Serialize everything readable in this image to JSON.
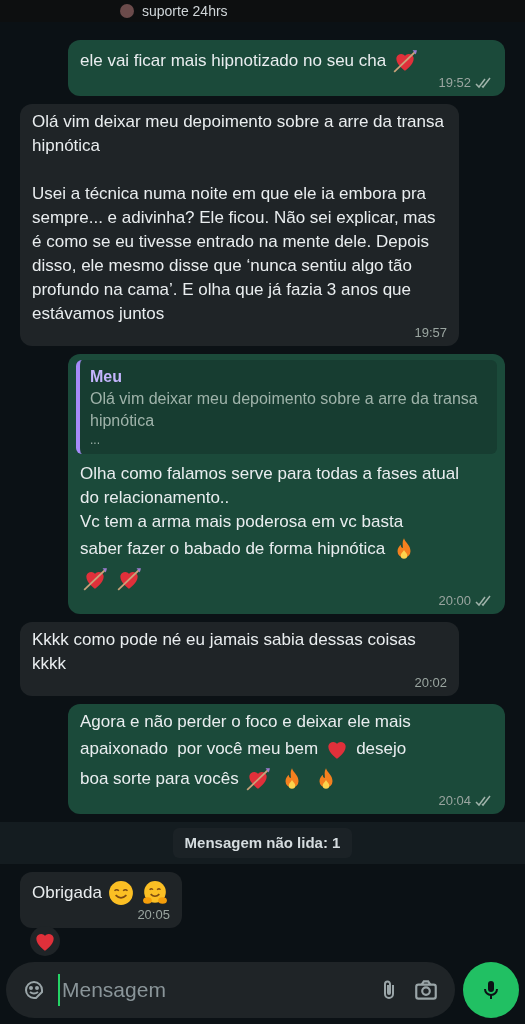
{
  "header": {
    "subtitle": "suporte 24hrs"
  },
  "messages": [
    {
      "kind": "outgoing",
      "time": "19:52",
      "read": false,
      "lines": [
        [
          {
            "kind": "text",
            "text": "ele vai ficar mais hipnotizado no seu cha"
          },
          {
            "kind": "arrow_heart"
          }
        ]
      ]
    },
    {
      "kind": "incoming",
      "time": "19:57",
      "lines": [
        [
          {
            "kind": "text",
            "text": "Olá vim deixar meu depoimento sobre a arre da transa hipnótica\n\nUsei a técnica numa noite em que ele ia embora pra sempre... e adivinha? Ele ficou. Não sei explicar, mas é como se eu tivesse entrado na mente dele. Depois disso, ele mesmo disse que ‘nunca sentiu algo tão profundo na cama’. E olha que já fazia 3 anos que estávamos juntos"
          }
        ]
      ]
    },
    {
      "kind": "outgoing",
      "time": "20:00",
      "read": false,
      "quote": {
        "author": "Meu",
        "text": "Olá vim deixar meu depoimento sobre a arre da transa hipnótica",
        "more": "..."
      },
      "lines": [
        [
          {
            "kind": "text",
            "text": "Olha como falamos serve para todas a fases atual do relacionamento..\nVc tem a arma mais poderosa em vc basta"
          }
        ],
        [
          {
            "kind": "text",
            "text": "saber fazer o babado de forma hipnótica"
          },
          {
            "kind": "fire"
          }
        ],
        [
          {
            "kind": "arrow_heart"
          },
          {
            "kind": "arrow_heart"
          }
        ]
      ]
    },
    {
      "kind": "incoming",
      "time": "20:02",
      "lines": [
        [
          {
            "kind": "text",
            "text": "Kkkk como pode né eu jamais sabia dessas coisas kkkk"
          }
        ]
      ]
    },
    {
      "kind": "outgoing",
      "time": "20:04",
      "read": false,
      "lines": [
        [
          {
            "kind": "text",
            "text": "Agora e não perder o foco e deixar ele mais"
          }
        ],
        [
          {
            "kind": "text",
            "text": "apaixonado  por você meu bem"
          },
          {
            "kind": "heart"
          },
          {
            "kind": "text",
            "text": "desejo"
          }
        ],
        [
          {
            "kind": "text",
            "text": "boa sorte para vocês"
          },
          {
            "kind": "arrow_heart"
          },
          {
            "kind": "fire"
          },
          {
            "kind": "fire"
          }
        ]
      ]
    },
    {
      "kind": "unread",
      "text": "Mensagem não lida: 1"
    },
    {
      "kind": "incoming",
      "time": "20:05",
      "reaction": {
        "kind": "heart"
      },
      "lines": [
        [
          {
            "kind": "text",
            "text": "Obrigada"
          },
          {
            "kind": "smile"
          },
          {
            "kind": "hug"
          }
        ]
      ]
    }
  ],
  "composer": {
    "placeholder": "Mensagem"
  }
}
